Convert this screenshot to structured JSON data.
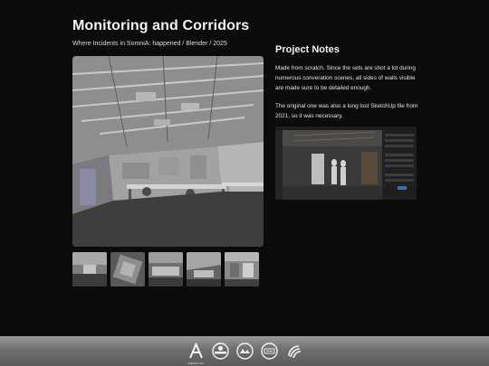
{
  "page": {
    "title": "Monitoring and Corridors",
    "subtitle": "Where Incidents in SomniA: happened / Blender / 2025"
  },
  "gallery": {
    "main_image": "monitoring-room-render",
    "thumbnails": [
      "thumb-1",
      "thumb-2",
      "thumb-3",
      "thumb-4",
      "thumb-5"
    ]
  },
  "notes": {
    "heading": "Project Notes",
    "paragraphs": [
      "Made from scratch. Since the sets are shot a lot during numerous converation scenes, all sides of walls visible are made sure to be detailed enough.",
      "The original one was also a long lost SketchUp file from 2021, so it was necessary."
    ],
    "screenshot": "blender-viewport-screenshot"
  },
  "footer": {
    "logos": [
      {
        "name": "atlantic-a-logo",
        "caption": "Atlantic Ctrl"
      },
      {
        "name": "circle-emblem-logo-1",
        "caption": ""
      },
      {
        "name": "circle-emblem-logo-2",
        "caption": ""
      },
      {
        "name": "circle-emblem-logo-3",
        "caption": ""
      },
      {
        "name": "swirl-logo",
        "caption": ""
      }
    ]
  },
  "colors": {
    "background": "#0b0b0b",
    "text": "#e8e8e8",
    "footer_gradient_top": "#9a9a9a",
    "footer_gradient_bottom": "#5b5b5b"
  }
}
